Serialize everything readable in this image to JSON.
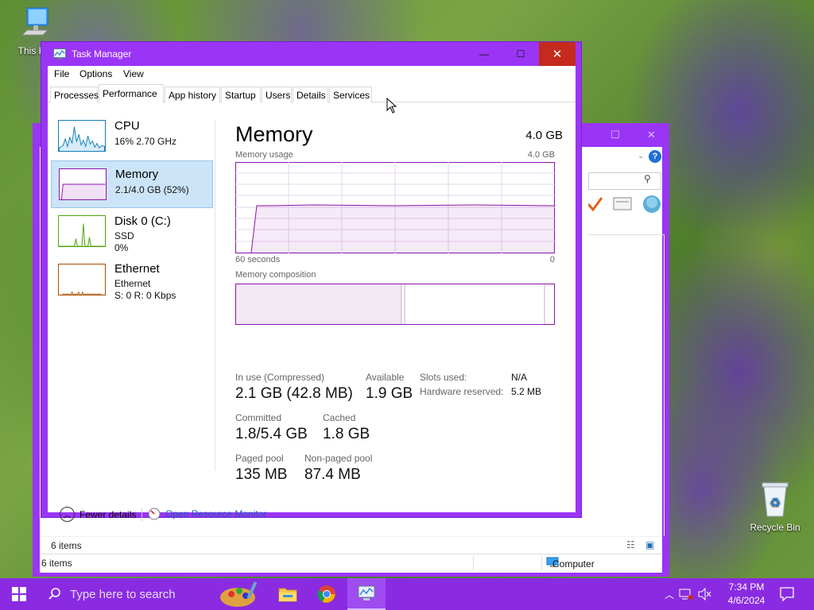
{
  "desktop": {
    "icons": [
      {
        "label": "This PC"
      },
      {
        "label": "Recycle Bin"
      }
    ]
  },
  "explorer": {
    "status_items": "6 items",
    "status_items_bottom": "6 items",
    "status_location": "Computer",
    "help_label": "?"
  },
  "taskmgr": {
    "title": "Task Manager",
    "controls": {
      "minimize": "—",
      "maximize": "☐",
      "close": "✕"
    },
    "menu": [
      "File",
      "Options",
      "View"
    ],
    "tabs": [
      "Processes",
      "Performance",
      "App history",
      "Startup",
      "Users",
      "Details",
      "Services"
    ],
    "active_tab": "Performance",
    "resources": [
      {
        "name": "CPU",
        "sub1": "16% 2.70 GHz",
        "sub2": "",
        "sub3": "",
        "color": "#117dbb"
      },
      {
        "name": "Memory",
        "sub1": "2.1/4.0 GB (52%)",
        "sub2": "",
        "sub3": "",
        "color": "#8b12ae",
        "usage": 0.52
      },
      {
        "name": "Disk 0 (C:)",
        "sub1": "SSD",
        "sub2": "0%",
        "sub3": "",
        "color": "#4da60c"
      },
      {
        "name": "Ethernet",
        "sub1": "Ethernet",
        "sub2": "S: 0 R: 0 Kbps",
        "sub3": "",
        "color": "#a74f01"
      }
    ],
    "detail": {
      "title": "Memory",
      "total": "4.0 GB",
      "usage_label": "Memory usage",
      "usage_max": "4.0 GB",
      "time_left": "60 seconds",
      "time_right": "0",
      "composition_label": "Memory composition",
      "stats": {
        "in_use_label": "In use (Compressed)",
        "in_use_value": "2.1 GB (42.8 MB)",
        "available_label": "Available",
        "available_value": "1.9 GB",
        "committed_label": "Committed",
        "committed_value": "1.8/5.4 GB",
        "cached_label": "Cached",
        "cached_value": "1.8 GB",
        "paged_label": "Paged pool",
        "paged_value": "135 MB",
        "nonpaged_label": "Non-paged pool",
        "nonpaged_value": "87.4 MB",
        "slots_label": "Slots used:",
        "slots_value": "N/A",
        "hw_reserved_label": "Hardware reserved:",
        "hw_reserved_value": "5.2 MB"
      },
      "usage_fraction": 0.52,
      "composition": {
        "in_use_fraction": 0.52,
        "modified_fraction": 0.01,
        "standby_fraction": 0.44
      }
    },
    "footer": {
      "fewer_details": "Fewer details",
      "open_resource_monitor": "Open Resource Monitor"
    }
  },
  "taskbar": {
    "search_placeholder": "Type here to search",
    "time": "7:34 PM",
    "date": "4/6/2024",
    "accent": "#8a2be2"
  }
}
